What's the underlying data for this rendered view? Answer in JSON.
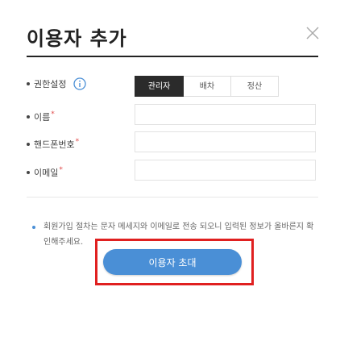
{
  "dialog": {
    "title": "이용자 추가",
    "close_icon": "close-icon"
  },
  "form": {
    "role": {
      "label": "권한설정",
      "info_icon": "info-icon",
      "options": [
        {
          "label": "관리자",
          "selected": true
        },
        {
          "label": "배차",
          "selected": false
        },
        {
          "label": "정산",
          "selected": false
        }
      ]
    },
    "name": {
      "label": "이름",
      "required": "*",
      "value": "",
      "placeholder": ""
    },
    "phone": {
      "label": "핸드폰번호",
      "required": "*",
      "value": "",
      "placeholder": ""
    },
    "email": {
      "label": "이메일",
      "required": "*",
      "value": "",
      "placeholder": ""
    }
  },
  "notice": {
    "text": "회원가입 절차는 문자 메세지와 이메일로 전송 되오니 입력된 정보가 올바른지 확인해주세요."
  },
  "actions": {
    "invite_label": "이용자 초대"
  },
  "colors": {
    "accent": "#4a8fd6",
    "highlight": "#e02020",
    "selected_role_bg": "#2b2b2b"
  }
}
